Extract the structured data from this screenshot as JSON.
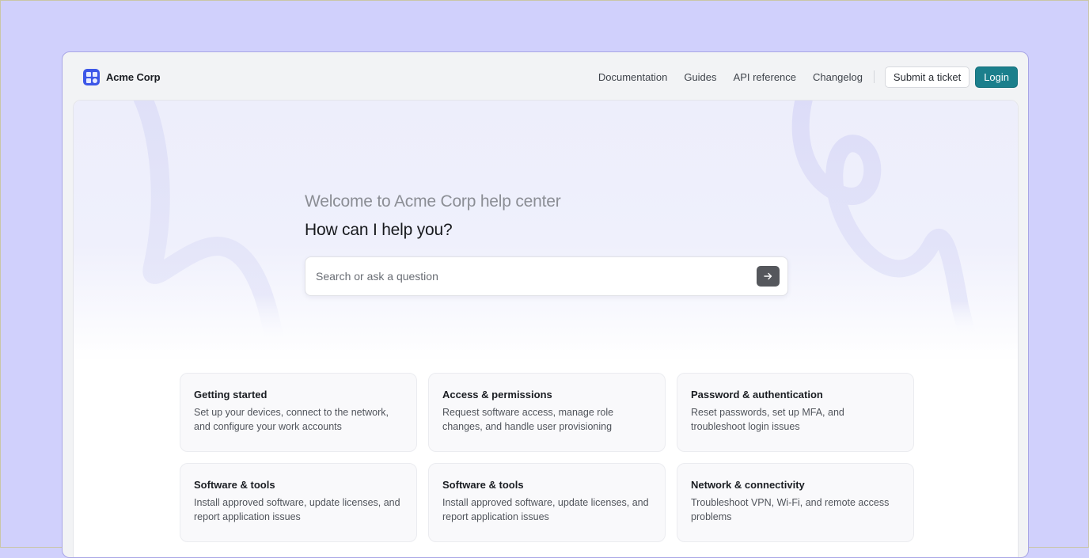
{
  "brand": {
    "name": "Acme Corp",
    "logo_icon": "grid-logo-icon"
  },
  "nav": {
    "links": [
      "Documentation",
      "Guides",
      "API reference",
      "Changelog"
    ],
    "submit_ticket": "Submit a ticket",
    "login": "Login"
  },
  "hero": {
    "welcome": "Welcome to Acme Corp help center",
    "question": "How can I help you?"
  },
  "search": {
    "placeholder": "Search or ask a question",
    "value": "",
    "submit_icon": "arrow-right-icon"
  },
  "cards": [
    {
      "title": "Getting started",
      "description": "Set up your devices, connect to the network, and configure your work accounts"
    },
    {
      "title": "Access & permissions",
      "description": "Request software access, manage role changes, and handle user provisioning"
    },
    {
      "title": "Password & authentication",
      "description": "Reset passwords, set up MFA, and troubleshoot login issues"
    },
    {
      "title": "Software & tools",
      "description": "Install approved software, update licenses, and report application issues"
    },
    {
      "title": "Software & tools",
      "description": "Install approved software, update licenses, and report application issues"
    },
    {
      "title": "Network & connectivity",
      "description": "Troubleshoot VPN, Wi-Fi, and remote access problems"
    }
  ],
  "colors": {
    "page_background": "#d0d0fc",
    "accent_login": "#1b7f8c",
    "brand_logo": "#3d57e8",
    "hero_tint": "#edeefb"
  }
}
